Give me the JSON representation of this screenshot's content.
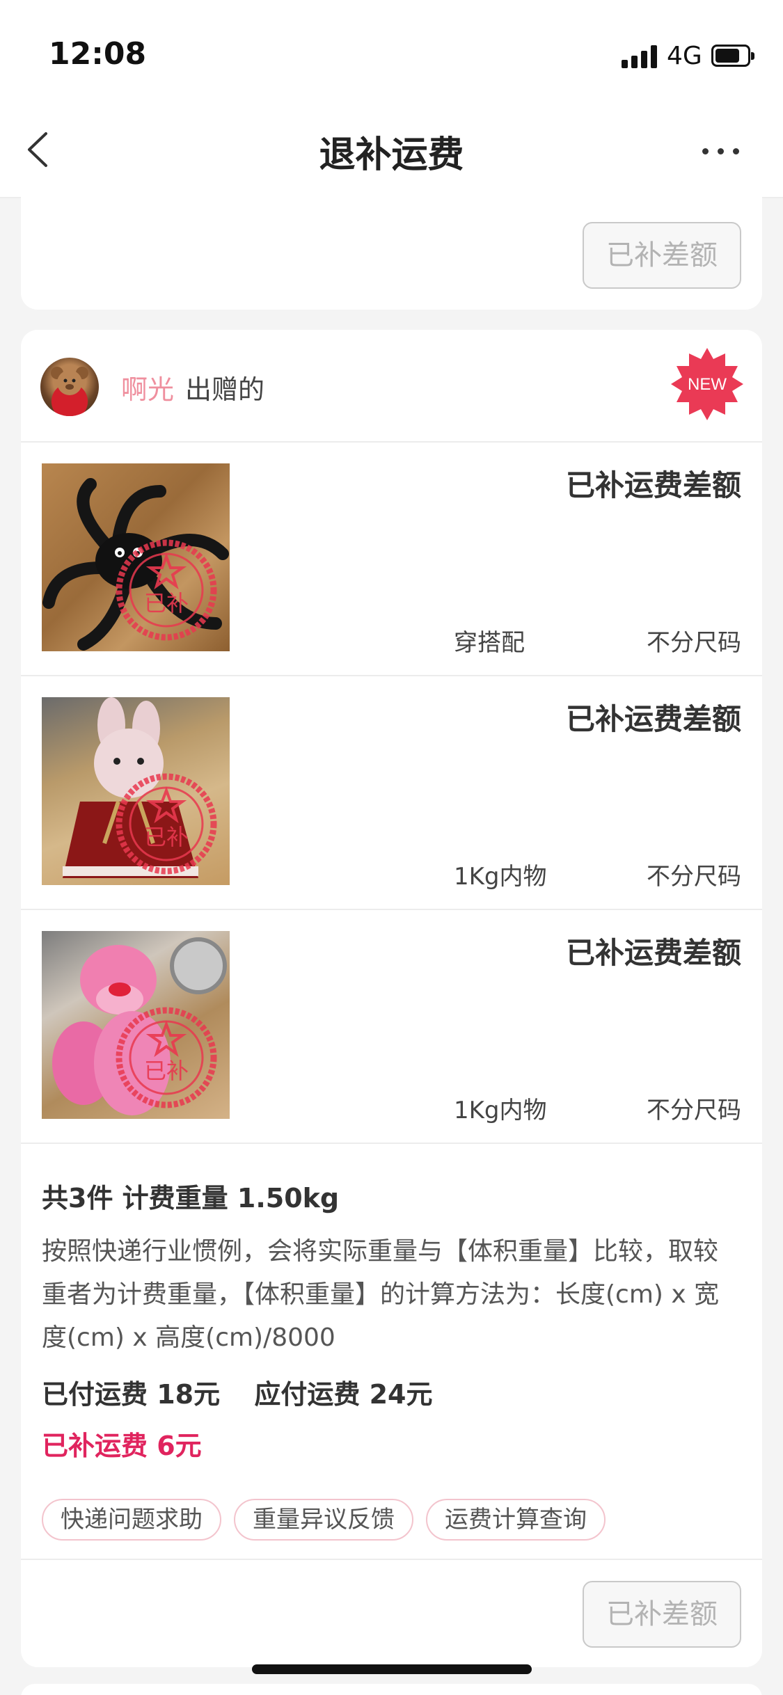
{
  "status_bar": {
    "time": "12:08",
    "network": "4G"
  },
  "nav": {
    "title": "退补运费"
  },
  "top_card": {
    "button_label": "已补差额"
  },
  "order": {
    "seller_name": "啊光",
    "seller_suffix": "出赠的",
    "badge": "NEW",
    "items": [
      {
        "status": "已补运费差额",
        "category": "穿搭配",
        "size": "不分尺码",
        "stamp": "已补",
        "image": "black-spider-plush"
      },
      {
        "status": "已补运费差额",
        "category": "1Kg内物",
        "size": "不分尺码",
        "stamp": "已补",
        "image": "rabbit-plush-red-dress"
      },
      {
        "status": "已补运费差额",
        "category": "1Kg内物",
        "size": "不分尺码",
        "stamp": "已补",
        "image": "pink-panther-plush"
      }
    ],
    "summary": {
      "title": "共3件 计费重量 1.50kg",
      "description": "按照快递行业惯例，会将实际重量与【体积重量】比较，取较重者为计费重量，【体积重量】的计算方法为：长度(cm) x 宽度(cm) x 高度(cm)/8000",
      "paid": "已付运费 18元",
      "due": "应付运费 24元",
      "refunded": "已补运费 6元"
    },
    "tags": [
      "快递问题求助",
      "重量异议反馈",
      "运费计算查询"
    ],
    "button_label": "已补差额"
  },
  "colors": {
    "accent_red": "#e0245e",
    "stamp_red": "#e8384f",
    "seller_pink": "#ef8f9e",
    "disabled_text": "#b3b3b3"
  }
}
